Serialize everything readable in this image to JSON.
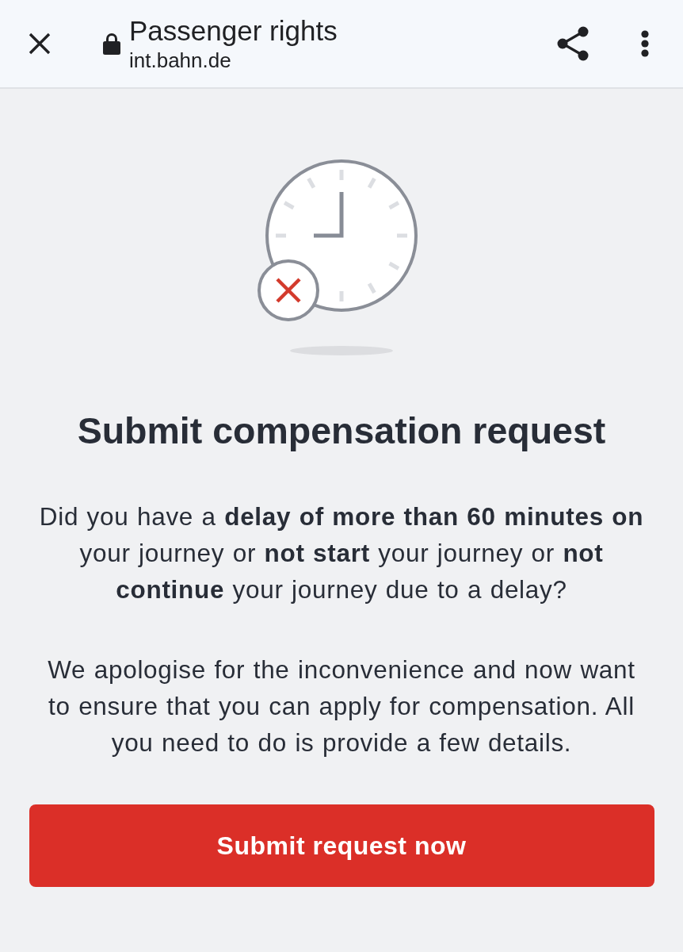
{
  "browser_bar": {
    "title": "Passenger rights",
    "url": "int.bahn.de"
  },
  "content": {
    "heading": "Submit compensation request",
    "paragraphs": [
      "Did you have a **delay of more than 60 minutes on** your journey or **not start** your journey or **not continue** your journey due to a delay?",
      "We apologise for the inconvenience and now want to ensure that you can apply for compensation. All you need to do is provide a few details."
    ],
    "button": "Submit request now"
  }
}
